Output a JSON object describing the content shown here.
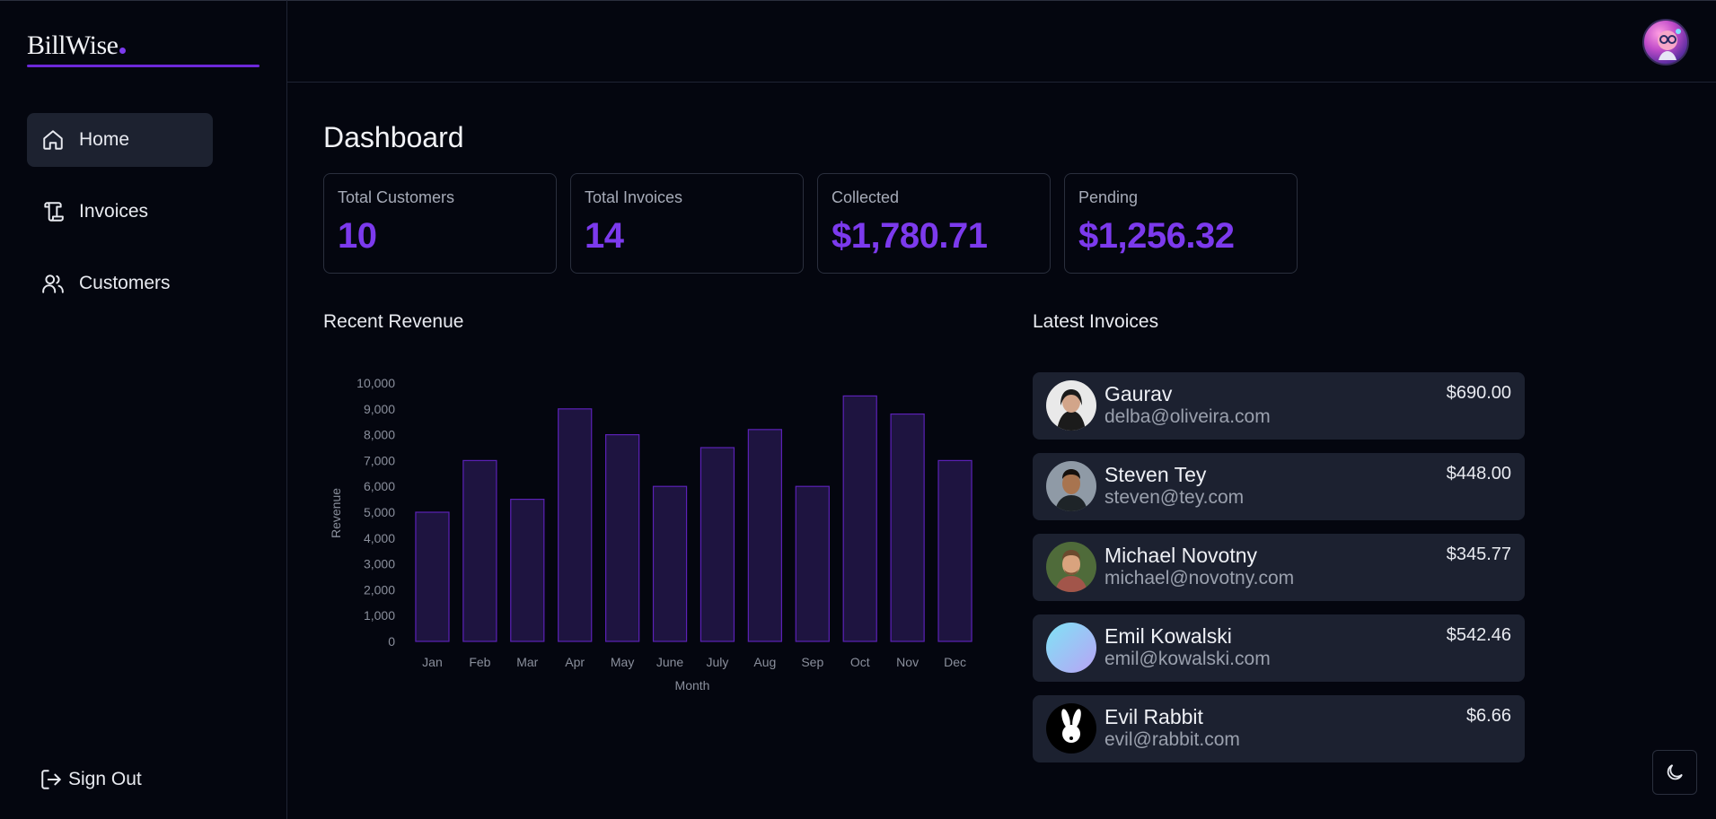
{
  "app": {
    "logo": "BillWise"
  },
  "sidebar": {
    "items": [
      {
        "label": "Home",
        "icon": "home-icon",
        "active": true
      },
      {
        "label": "Invoices",
        "icon": "invoice-icon",
        "active": false
      },
      {
        "label": "Customers",
        "icon": "users-icon",
        "active": false
      }
    ],
    "signout_label": "Sign Out"
  },
  "main": {
    "title": "Dashboard",
    "cards": [
      {
        "label": "Total Customers",
        "value": "10"
      },
      {
        "label": "Total Invoices",
        "value": "14"
      },
      {
        "label": "Collected",
        "value": "$1,780.71"
      },
      {
        "label": "Pending",
        "value": "$1,256.32"
      }
    ],
    "revenue_title": "Recent Revenue",
    "latest_title": "Latest Invoices",
    "latest_invoices": [
      {
        "name": "Gaurav",
        "email": "delba@oliveira.com",
        "amount": "$690.00"
      },
      {
        "name": "Steven Tey",
        "email": "steven@tey.com",
        "amount": "$448.00"
      },
      {
        "name": "Michael Novotny",
        "email": "michael@novotny.com",
        "amount": "$345.77"
      },
      {
        "name": "Emil Kowalski",
        "email": "emil@kowalski.com",
        "amount": "$542.46"
      },
      {
        "name": "Evil Rabbit",
        "email": "evil@rabbit.com",
        "amount": "$6.66"
      }
    ]
  },
  "colors": {
    "accent": "#7c3aed",
    "bar_fill": "#1e1440",
    "bar_stroke": "#5b21b6",
    "card_bg": "#1c2130"
  },
  "chart_data": {
    "type": "bar",
    "categories": [
      "Jan",
      "Feb",
      "Mar",
      "Apr",
      "May",
      "June",
      "July",
      "Aug",
      "Sep",
      "Oct",
      "Nov",
      "Dec"
    ],
    "values": [
      5000,
      7000,
      5500,
      9000,
      8000,
      6000,
      7500,
      8200,
      6000,
      9500,
      8800,
      7000
    ],
    "xlabel": "Month",
    "ylabel": "Revenue",
    "ylim": [
      0,
      10000
    ],
    "yticks": [
      0,
      1000,
      2000,
      3000,
      4000,
      5000,
      6000,
      7000,
      8000,
      9000,
      10000
    ],
    "ytick_labels": [
      "0",
      "1,000",
      "2,000",
      "3,000",
      "4,000",
      "5,000",
      "6,000",
      "7,000",
      "8,000",
      "9,000",
      "10,000"
    ],
    "grid": false,
    "legend": "none"
  }
}
